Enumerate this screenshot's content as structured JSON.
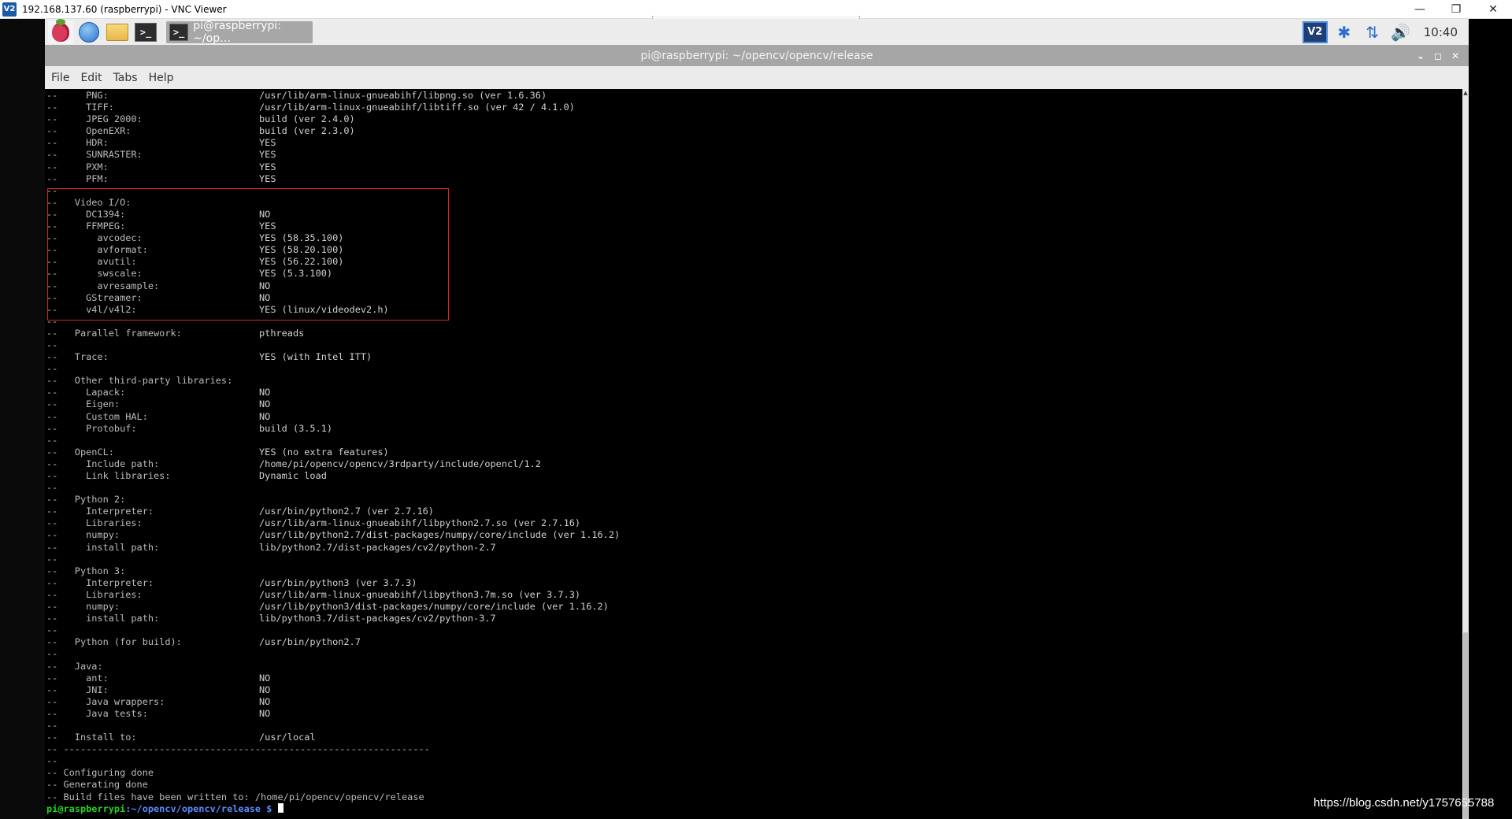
{
  "vnc": {
    "logo": "V2",
    "title": "192.168.137.60 (raspberrypi) - VNC Viewer",
    "min_icon": "—",
    "restore_icon": "❐",
    "close_icon": "✕"
  },
  "panel": {
    "launchers": [
      "raspberry-menu-icon",
      "web-browser-icon",
      "file-manager-icon",
      "terminal-icon"
    ],
    "terminal_glyph": ">_",
    "task_label": "pi@raspberrypi: ~/op…",
    "tray": {
      "vnc_label": "V2",
      "bluetooth_icon": "✱",
      "network_icon": "⇅",
      "volume_icon": "🔊",
      "clock": "10:40"
    }
  },
  "terminal": {
    "title": "pi@raspberrypi: ~/opencv/opencv/release",
    "controls": [
      "⌄",
      "◻",
      "✕"
    ],
    "menu": [
      "File",
      "Edit",
      "Tabs",
      "Help"
    ],
    "lines": [
      {
        "k": "--     PNG:",
        "v": "/usr/lib/arm-linux-gnueabihf/libpng.so (ver 1.6.36)"
      },
      {
        "k": "--     TIFF:",
        "v": "/usr/lib/arm-linux-gnueabihf/libtiff.so (ver 42 / 4.1.0)"
      },
      {
        "k": "--     JPEG 2000:",
        "v": "build (ver 2.4.0)"
      },
      {
        "k": "--     OpenEXR:",
        "v": "build (ver 2.3.0)"
      },
      {
        "k": "--     HDR:",
        "v": "YES"
      },
      {
        "k": "--     SUNRASTER:",
        "v": "YES"
      },
      {
        "k": "--     PXM:",
        "v": "YES"
      },
      {
        "k": "--     PFM:",
        "v": "YES"
      },
      {
        "k": "--",
        "v": ""
      },
      {
        "k": "--   Video I/O:",
        "v": ""
      },
      {
        "k": "--     DC1394:",
        "v": "NO"
      },
      {
        "k": "--     FFMPEG:",
        "v": "YES"
      },
      {
        "k": "--       avcodec:",
        "v": "YES (58.35.100)"
      },
      {
        "k": "--       avformat:",
        "v": "YES (58.20.100)"
      },
      {
        "k": "--       avutil:",
        "v": "YES (56.22.100)"
      },
      {
        "k": "--       swscale:",
        "v": "YES (5.3.100)"
      },
      {
        "k": "--       avresample:",
        "v": "NO"
      },
      {
        "k": "--     GStreamer:",
        "v": "NO"
      },
      {
        "k": "--     v4l/v4l2:",
        "v": "YES (linux/videodev2.h)"
      },
      {
        "k": "--",
        "v": ""
      },
      {
        "k": "--   Parallel framework:",
        "v": "pthreads"
      },
      {
        "k": "--",
        "v": ""
      },
      {
        "k": "--   Trace:",
        "v": "YES (with Intel ITT)"
      },
      {
        "k": "--",
        "v": ""
      },
      {
        "k": "--   Other third-party libraries:",
        "v": ""
      },
      {
        "k": "--     Lapack:",
        "v": "NO"
      },
      {
        "k": "--     Eigen:",
        "v": "NO"
      },
      {
        "k": "--     Custom HAL:",
        "v": "NO"
      },
      {
        "k": "--     Protobuf:",
        "v": "build (3.5.1)"
      },
      {
        "k": "--",
        "v": ""
      },
      {
        "k": "--   OpenCL:",
        "v": "YES (no extra features)"
      },
      {
        "k": "--     Include path:",
        "v": "/home/pi/opencv/opencv/3rdparty/include/opencl/1.2"
      },
      {
        "k": "--     Link libraries:",
        "v": "Dynamic load"
      },
      {
        "k": "--",
        "v": ""
      },
      {
        "k": "--   Python 2:",
        "v": ""
      },
      {
        "k": "--     Interpreter:",
        "v": "/usr/bin/python2.7 (ver 2.7.16)"
      },
      {
        "k": "--     Libraries:",
        "v": "/usr/lib/arm-linux-gnueabihf/libpython2.7.so (ver 2.7.16)"
      },
      {
        "k": "--     numpy:",
        "v": "/usr/lib/python2.7/dist-packages/numpy/core/include (ver 1.16.2)"
      },
      {
        "k": "--     install path:",
        "v": "lib/python2.7/dist-packages/cv2/python-2.7"
      },
      {
        "k": "--",
        "v": ""
      },
      {
        "k": "--   Python 3:",
        "v": ""
      },
      {
        "k": "--     Interpreter:",
        "v": "/usr/bin/python3 (ver 3.7.3)"
      },
      {
        "k": "--     Libraries:",
        "v": "/usr/lib/arm-linux-gnueabihf/libpython3.7m.so (ver 3.7.3)"
      },
      {
        "k": "--     numpy:",
        "v": "/usr/lib/python3/dist-packages/numpy/core/include (ver 1.16.2)"
      },
      {
        "k": "--     install path:",
        "v": "lib/python3.7/dist-packages/cv2/python-3.7"
      },
      {
        "k": "--",
        "v": ""
      },
      {
        "k": "--   Python (for build):",
        "v": "/usr/bin/python2.7"
      },
      {
        "k": "--",
        "v": ""
      },
      {
        "k": "--   Java:",
        "v": ""
      },
      {
        "k": "--     ant:",
        "v": "NO"
      },
      {
        "k": "--     JNI:",
        "v": "NO"
      },
      {
        "k": "--     Java wrappers:",
        "v": "NO"
      },
      {
        "k": "--     Java tests:",
        "v": "NO"
      },
      {
        "k": "--",
        "v": ""
      },
      {
        "k": "--   Install to:",
        "v": "/usr/local"
      },
      {
        "k": "-- -----------------------------------------------------------------",
        "v": ""
      },
      {
        "k": "--",
        "v": ""
      },
      {
        "k": "-- Configuring done",
        "v": ""
      },
      {
        "k": "-- Generating done",
        "v": ""
      },
      {
        "k": "-- Build files have been written to: /home/pi/opencv/opencv/release",
        "v": ""
      }
    ],
    "prompt": {
      "user": "pi@raspberrypi",
      "path": ":~/opencv/opencv/release $ "
    }
  },
  "watermark": "https://blog.csdn.net/y1757655788"
}
